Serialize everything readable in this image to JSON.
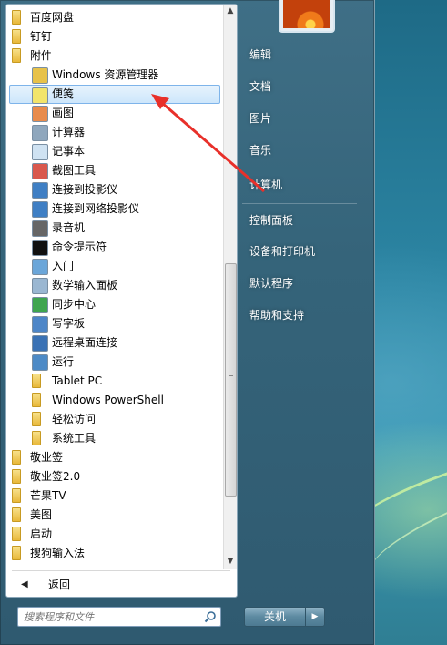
{
  "colors": {
    "accent_red": "#e8302a",
    "selection_bg": "#cde6fb",
    "folder": "#e8b83a"
  },
  "programs": [
    {
      "label": "百度网盘",
      "icon": "folder-icon",
      "level": "top"
    },
    {
      "label": "钉钉",
      "icon": "folder-icon",
      "level": "top"
    },
    {
      "label": "附件",
      "icon": "folder-icon",
      "level": "top"
    },
    {
      "label": "Windows 资源管理器",
      "icon": "explorer-icon",
      "level": "sub"
    },
    {
      "label": "便笺",
      "icon": "sticky-notes-icon",
      "level": "sub",
      "selected": true
    },
    {
      "label": "画图",
      "icon": "paint-icon",
      "level": "sub"
    },
    {
      "label": "计算器",
      "icon": "calculator-icon",
      "level": "sub"
    },
    {
      "label": "记事本",
      "icon": "notepad-icon",
      "level": "sub"
    },
    {
      "label": "截图工具",
      "icon": "snipping-tool-icon",
      "level": "sub"
    },
    {
      "label": "连接到投影仪",
      "icon": "projector-icon",
      "level": "sub"
    },
    {
      "label": "连接到网络投影仪",
      "icon": "network-projector-icon",
      "level": "sub"
    },
    {
      "label": "录音机",
      "icon": "microphone-icon",
      "level": "sub"
    },
    {
      "label": "命令提示符",
      "icon": "command-prompt-icon",
      "level": "sub"
    },
    {
      "label": "入门",
      "icon": "getting-started-icon",
      "level": "sub"
    },
    {
      "label": "数学输入面板",
      "icon": "math-input-icon",
      "level": "sub"
    },
    {
      "label": "同步中心",
      "icon": "sync-center-icon",
      "level": "sub"
    },
    {
      "label": "写字板",
      "icon": "wordpad-icon",
      "level": "sub"
    },
    {
      "label": "远程桌面连接",
      "icon": "remote-desktop-icon",
      "level": "sub"
    },
    {
      "label": "运行",
      "icon": "run-icon",
      "level": "sub"
    },
    {
      "label": "Tablet PC",
      "icon": "folder-icon",
      "level": "sub"
    },
    {
      "label": "Windows PowerShell",
      "icon": "folder-icon",
      "level": "sub"
    },
    {
      "label": "轻松访问",
      "icon": "folder-icon",
      "level": "sub"
    },
    {
      "label": "系统工具",
      "icon": "folder-icon",
      "level": "sub"
    },
    {
      "label": "敬业签",
      "icon": "folder-icon",
      "level": "top"
    },
    {
      "label": "敬业签2.0",
      "icon": "folder-icon",
      "level": "top"
    },
    {
      "label": "芒果TV",
      "icon": "folder-icon",
      "level": "top"
    },
    {
      "label": "美图",
      "icon": "folder-icon",
      "level": "top"
    },
    {
      "label": "启动",
      "icon": "folder-icon",
      "level": "top"
    },
    {
      "label": "搜狗输入法",
      "icon": "folder-icon",
      "level": "top"
    }
  ],
  "back": {
    "label": "返回"
  },
  "search": {
    "placeholder": "搜索程序和文件"
  },
  "right_links": [
    "编辑",
    "文档",
    "图片",
    "音乐",
    "计算机",
    "控制面板",
    "设备和打印机",
    "默认程序",
    "帮助和支持"
  ],
  "shutdown": {
    "label": "关机",
    "arrow": "▶"
  },
  "scroll": {
    "up": "▲",
    "down": "▼"
  }
}
